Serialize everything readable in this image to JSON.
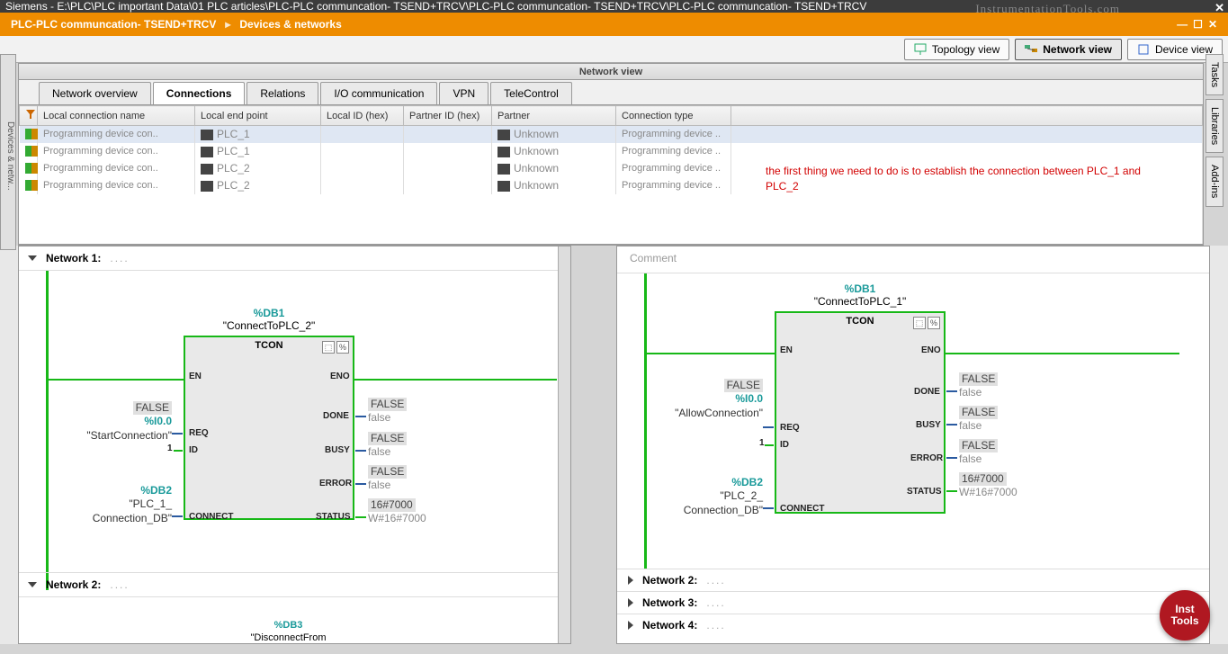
{
  "title_bar": "Siemens  -  E:\\PLC\\PLC important Data\\01 PLC articles\\PLC-PLC communcation- TSEND+TRCV\\PLC-PLC communcation- TSEND+TRCV\\PLC-PLC communcation- TSEND+TRCV",
  "watermark": "InstrumentationTools.com",
  "breadcrumb": {
    "a": "PLC-PLC communcation- TSEND+TRCV",
    "sep": "▸",
    "b": "Devices & networks"
  },
  "window_ctrls": {
    "min": "—",
    "max": "☐",
    "close": "✕"
  },
  "view_tabs": {
    "topology": "Topology view",
    "network": "Network view",
    "device": "Device view"
  },
  "nv_label": "Network view",
  "sub_tabs": [
    "Network overview",
    "Connections",
    "Relations",
    "I/O communication",
    "VPN",
    "TeleControl"
  ],
  "grid": {
    "cols": [
      "Local connection name",
      "Local end point",
      "Local ID (hex)",
      "Partner ID (hex)",
      "Partner",
      "Connection type"
    ],
    "rows": [
      {
        "n": "Programming device con..",
        "ep": "PLC_1",
        "p": "Unknown",
        "ct": "Programming device ..",
        "sel": true
      },
      {
        "n": "Programming device con..",
        "ep": "PLC_1",
        "p": "Unknown",
        "ct": "Programming device .."
      },
      {
        "n": "Programming device con..",
        "ep": "PLC_2",
        "p": "Unknown",
        "ct": "Programming device .."
      },
      {
        "n": "Programming device con..",
        "ep": "PLC_2",
        "p": "Unknown",
        "ct": "Programming device .."
      }
    ]
  },
  "annotation": "the first thing we need to do is to establish the connection between PLC_1 and PLC_2",
  "left_pane": {
    "net1": "Network 1:",
    "db": "%DB1",
    "dbname": "\"ConnectToPLC_2\"",
    "block": "TCON",
    "pins": {
      "en": "EN",
      "eno": "ENO",
      "req": "REQ",
      "id": "ID",
      "connect": "CONNECT",
      "done": "DONE",
      "busy": "BUSY",
      "error": "ERROR",
      "status": "STATUS"
    },
    "inputs": {
      "false": "FALSE",
      "start_tag": "%I0.0",
      "start_nm": "\"StartConnection\"",
      "one": "1",
      "db2": "%DB2",
      "db2nm1": "\"PLC_1_",
      "db2nm2": "Connection_DB\""
    },
    "outputs": {
      "falseL": "FALSE",
      "falseV": "false",
      "hex": "16#7000",
      "hexV": "W#16#7000"
    },
    "net2": "Network 2:",
    "db3": "%DB3",
    "db3nm": "\"DisconnectFrom"
  },
  "right_pane": {
    "comment": "Comment",
    "db": "%DB1",
    "dbname": "\"ConnectToPLC_1\"",
    "block": "TCON",
    "inputs": {
      "false": "FALSE",
      "start_tag": "%I0.0",
      "start_nm": "\"AllowConnection\"",
      "one": "1",
      "db2": "%DB2",
      "db2nm1": "\"PLC_2_",
      "db2nm2": "Connection_DB\""
    },
    "outputs": {
      "falseL": "FALSE",
      "falseV": "false",
      "hex": "16#7000",
      "hexV": "W#16#7000"
    },
    "nets": [
      "Network 2:",
      "Network 3:",
      "Network 4:"
    ]
  },
  "side_tabs": [
    "Tasks",
    "Libraries",
    "Add-ins"
  ],
  "left_collapse": "Devices & netw...",
  "badge": {
    "l1": "Inst",
    "l2": "Tools"
  }
}
